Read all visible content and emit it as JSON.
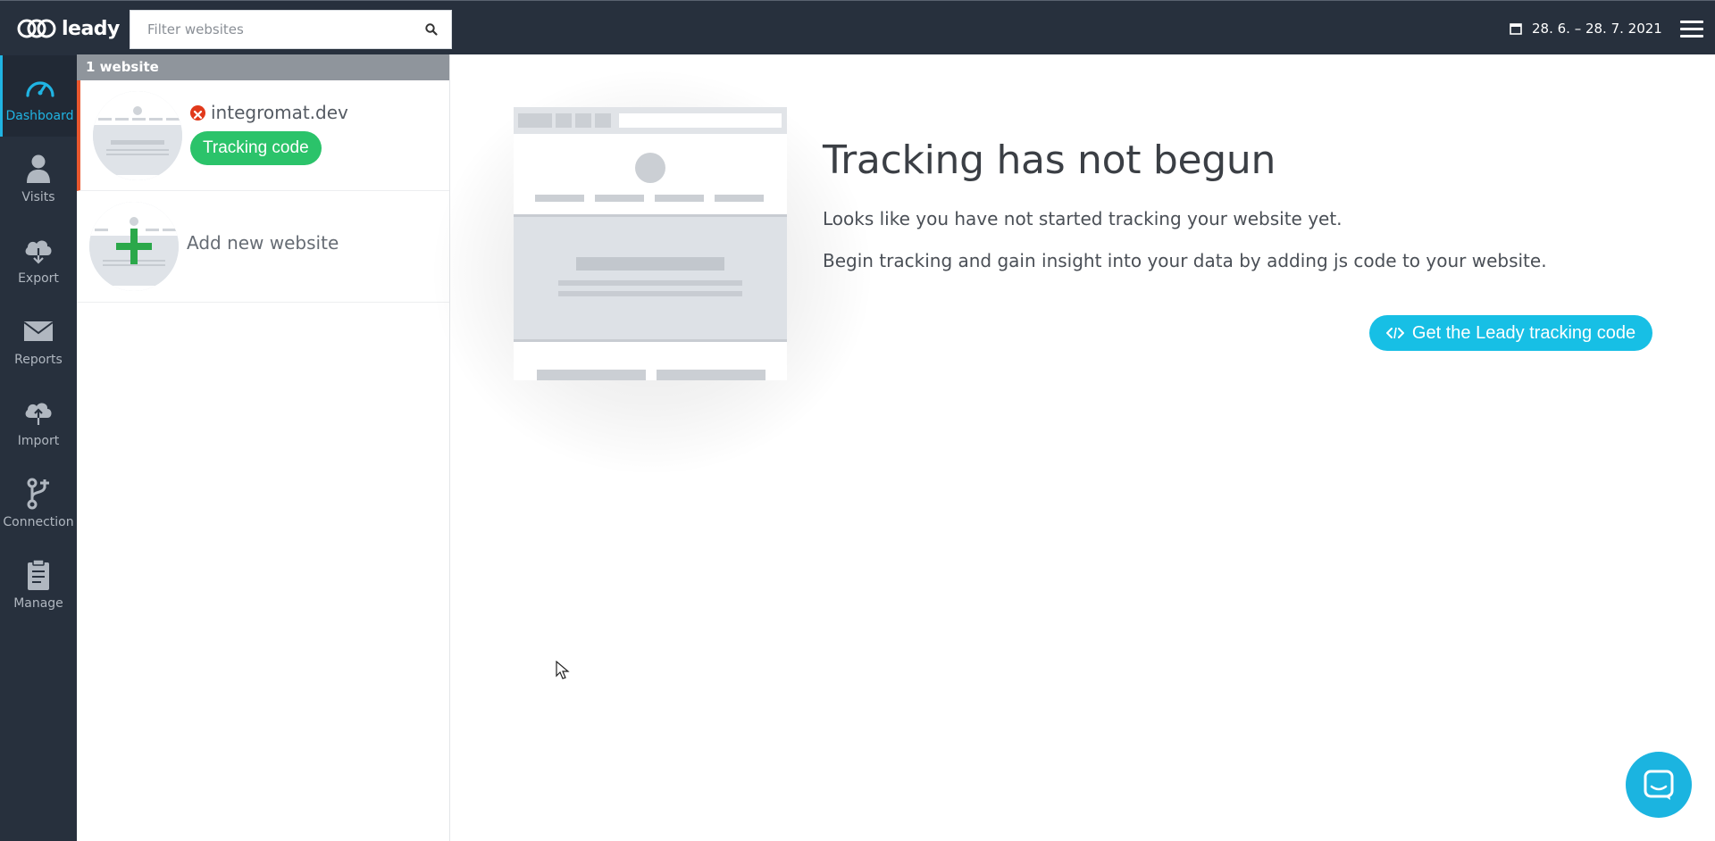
{
  "header": {
    "logo_text": "leady",
    "search_placeholder": "Filter websites",
    "date_range": "28. 6. – 28. 7. 2021"
  },
  "sidebar": {
    "items": [
      {
        "label": "Dashboard",
        "icon": "dashboard-gauge-icon",
        "active": true
      },
      {
        "label": "Visits",
        "icon": "user-icon"
      },
      {
        "label": "Export",
        "icon": "cloud-download-icon"
      },
      {
        "label": "Reports",
        "icon": "envelope-icon"
      },
      {
        "label": "Import",
        "icon": "cloud-upload-icon"
      },
      {
        "label": "Connection",
        "icon": "git-branch-icon"
      },
      {
        "label": "Manage",
        "icon": "clipboard-icon"
      }
    ]
  },
  "websites": {
    "count_label": "1 website",
    "items": [
      {
        "name": "integromat.dev",
        "status": "error",
        "button_label": "Tracking code"
      }
    ],
    "add_label": "Add new website"
  },
  "main": {
    "title": "Tracking has not begun",
    "line1": "Looks like you have not started tracking your website yet.",
    "line2": "Begin tracking and gain insight into your data by adding js code to your website.",
    "cta_label": "Get the Leady tracking code"
  },
  "colors": {
    "topbar": "#27303d",
    "accent": "#17bfe5",
    "success": "#2bc36a",
    "error": "#e1391b"
  }
}
